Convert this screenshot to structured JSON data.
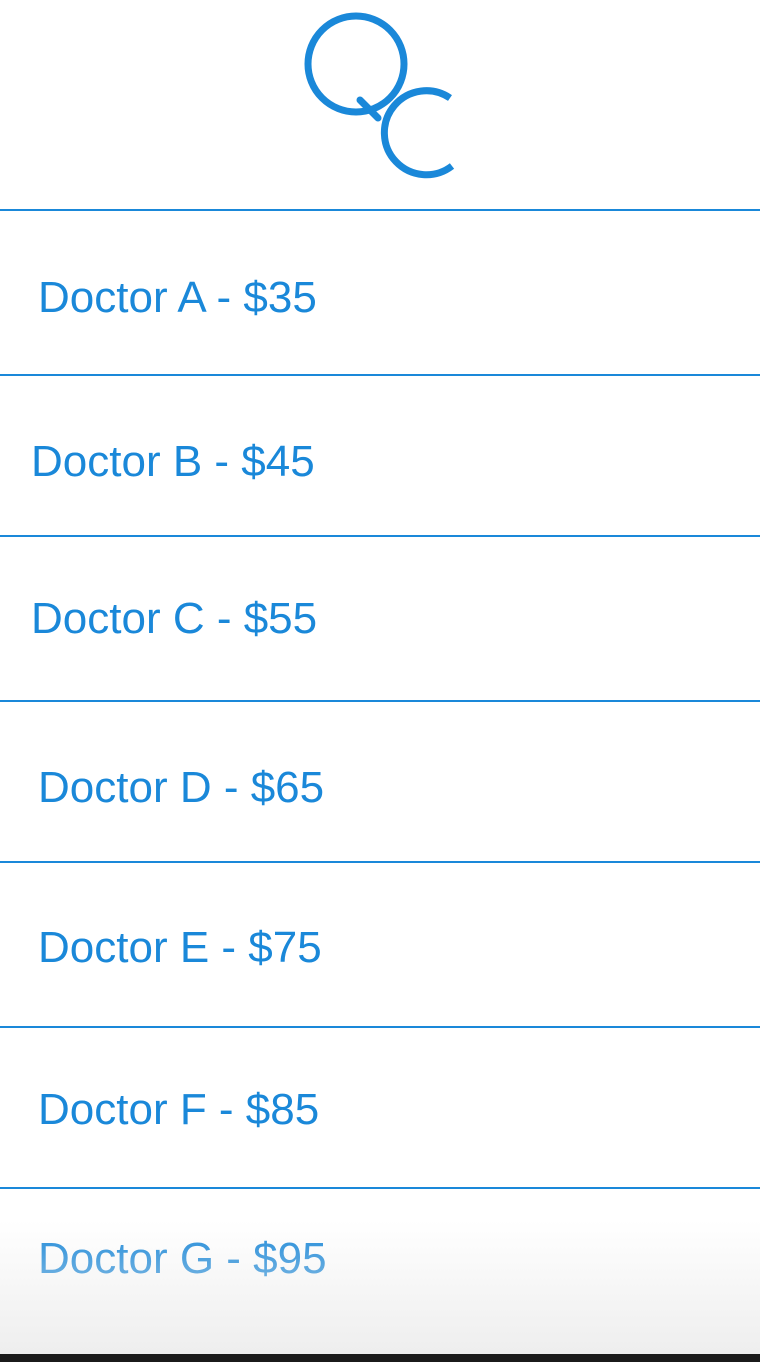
{
  "theme": {
    "accent": "#1a88d9",
    "background": "#ffffff"
  },
  "header": {
    "logo_icon": "qc-logo-icon"
  },
  "doctors": [
    {
      "label": "Doctor A - $35"
    },
    {
      "label": "Doctor B - $45"
    },
    {
      "label": "Doctor C - $55"
    },
    {
      "label": "Doctor D - $65"
    },
    {
      "label": "Doctor E - $75"
    },
    {
      "label": "Doctor F - $85"
    },
    {
      "label": "Doctor G - $95"
    }
  ]
}
